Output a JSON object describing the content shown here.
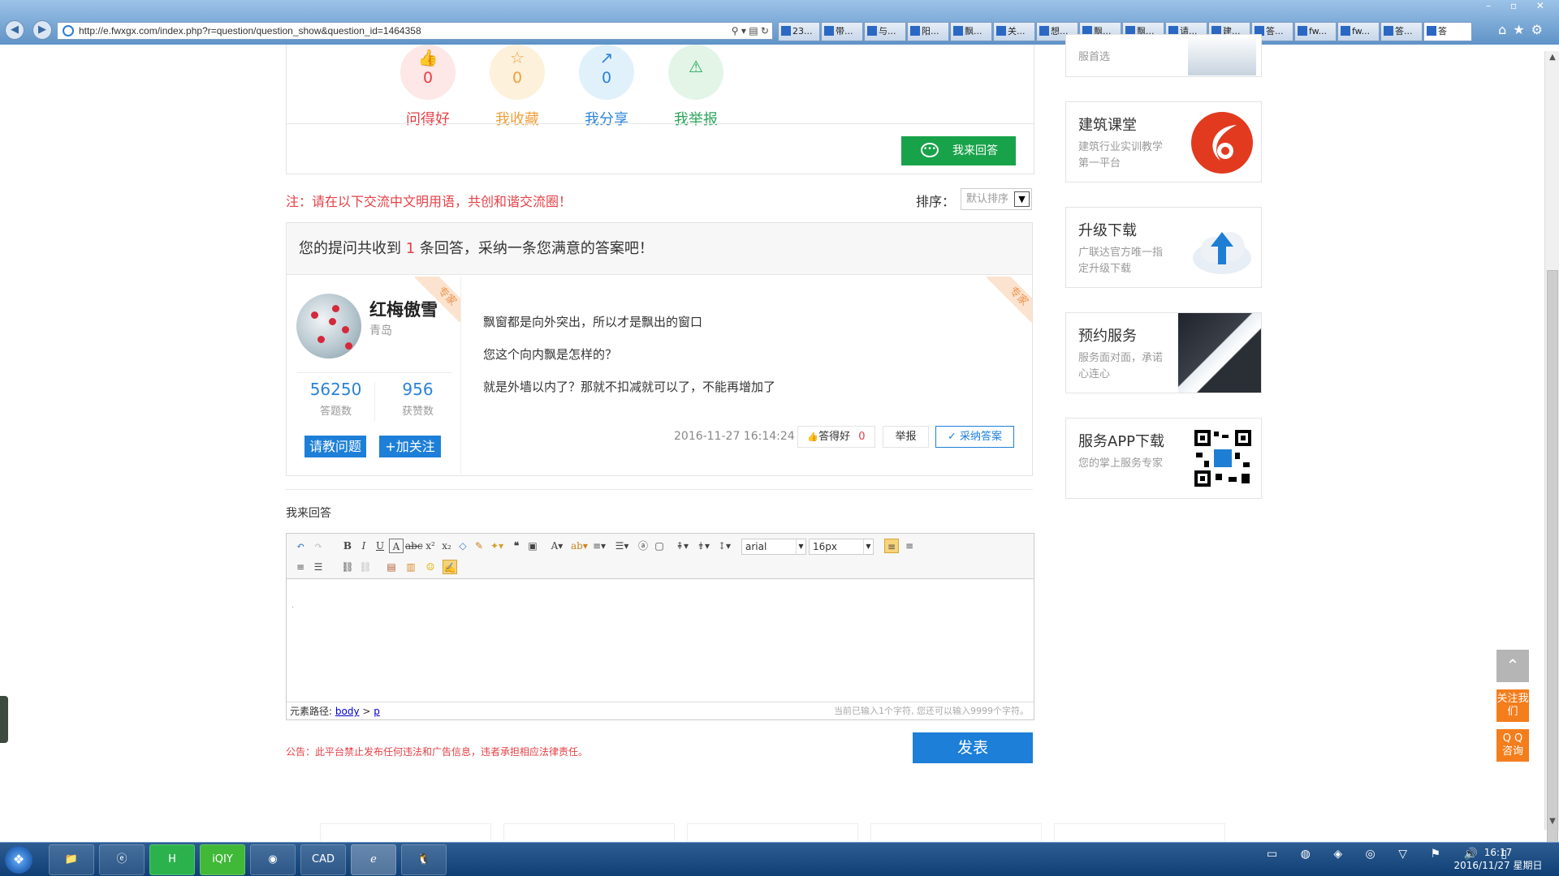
{
  "browser": {
    "url": "http://e.fwxgx.com/index.php?r=question/question_show&question_id=1464358",
    "tabs": [
      "23...",
      "带...",
      "与...",
      "阳...",
      "飘...",
      "关...",
      "想...",
      "飘...",
      "飘...",
      "请...",
      "建...",
      "答...",
      "fw...",
      "fw...",
      "答...",
      "答"
    ]
  },
  "actions": [
    {
      "icon": "thumb-up-icon",
      "glyph": "👍",
      "count": "0",
      "label": "问得好",
      "color": "#e64046",
      "bg": "#fde7e7"
    },
    {
      "icon": "star-icon",
      "glyph": "☆",
      "count": "0",
      "label": "我收藏",
      "color": "#f0a03c",
      "bg": "#fdf1dc"
    },
    {
      "icon": "share-icon",
      "glyph": "↗",
      "count": "0",
      "label": "我分享",
      "color": "#2a83d9",
      "bg": "#e1f1fb"
    },
    {
      "icon": "warning-icon",
      "glyph": "⚠",
      "count": "",
      "label": "我举报",
      "color": "#2aa65a",
      "bg": "#e2f5e7"
    }
  ],
  "reply_button": "我来回答",
  "notice": "注：请在以下交流中文明用语，共创和谐交流圈！",
  "sort": {
    "label": "排序：",
    "selected": "默认排序"
  },
  "answers_header": {
    "pre": "您的提问共收到",
    "count": "1",
    "post": "条回答，采纳一条您满意的答案吧！"
  },
  "ribbon_text": "专家",
  "answerer": {
    "name": "红梅傲雪",
    "city": "青岛",
    "answers": "56250",
    "answers_label": "答题数",
    "likes": "956",
    "likes_label": "获赞数",
    "ask_button": "请教问题",
    "follow_button": "+加关注"
  },
  "answer": {
    "lines": [
      "飘窗都是向外突出，所以才是飘出的窗口",
      "您这个向内飘是怎样的？",
      "就是外墙以内了？那就不扣减就可以了，不能再增加了"
    ],
    "time": "2016-11-27 16:14:24",
    "good_label": "答得好",
    "good_count": "0",
    "report_label": "举报",
    "accept_label": "采纳答案"
  },
  "editor": {
    "title": "我来回答",
    "font": "arial",
    "size": "16px",
    "path_label": "元素路径:",
    "path_body": "body",
    "path_sep": ">",
    "path_p": "p",
    "char_count": "当前已输入1个字符, 您还可以输入9999个字符。"
  },
  "disclaimer": "公告：此平台禁止发布任何违法和广告信息，违者承担相应法律责任。",
  "publish": "发表",
  "sidebar": [
    {
      "title": "",
      "subtitle": "服首选"
    },
    {
      "title": "建筑课堂",
      "subtitle": "建筑行业实训教学第一平台"
    },
    {
      "title": "升级下载",
      "subtitle": "广联达官方唯一指定升级下载"
    },
    {
      "title": "预约服务",
      "subtitle": "服务面对面，承诺心连心"
    },
    {
      "title": "服务APP下载",
      "subtitle": "您的掌上服务专家"
    }
  ],
  "float_buttons": {
    "follow": "关注我们",
    "qq": "Q Q 咨询"
  },
  "taskbar": {
    "time": "16:17",
    "date": "2016/11/27 星期日"
  }
}
